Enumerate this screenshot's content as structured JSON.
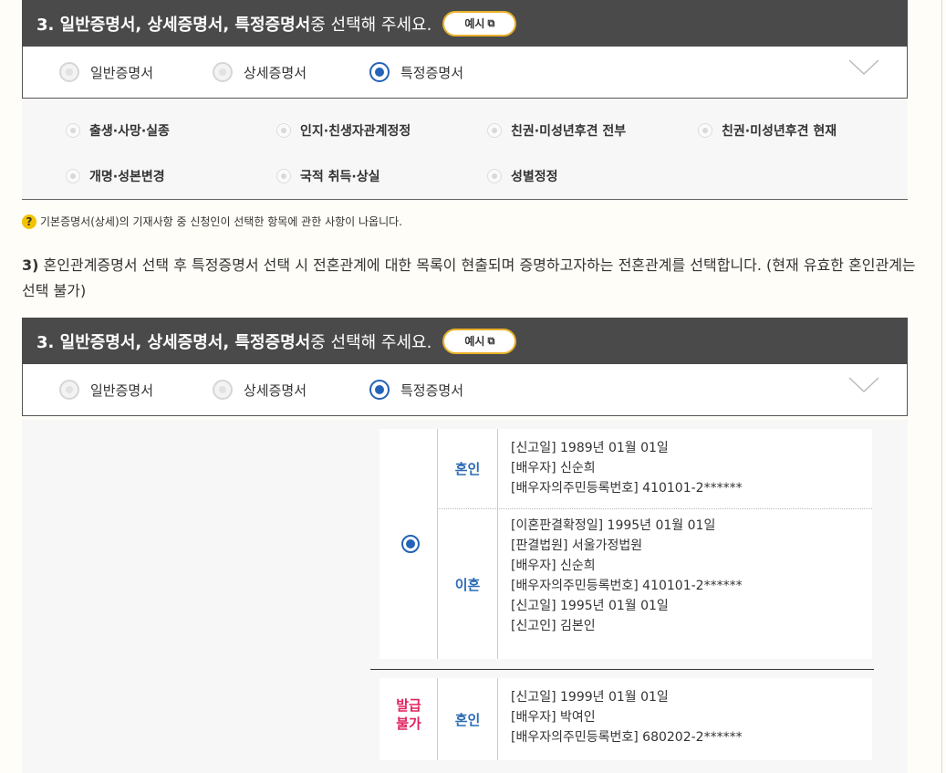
{
  "section_top": {
    "title_part1": "3. 일반증명서, 상세증명서, 특정증명서",
    "title_part2": " 중 선택해 주세요.",
    "example_button": "예시",
    "tabs": [
      "일반증명서",
      "상세증명서",
      "특정증명서"
    ],
    "selected_tab": "특정증명서"
  },
  "sub_options": [
    "출생·사망·실종",
    "인지·친생자관계정정",
    "친권·미성년후견 전부",
    "친권·미성년후견 현재",
    "개명·성본변경",
    "국적 취득·상실",
    "성별정정"
  ],
  "note": "기본증명서(상세)의 기재사항 중 신청인이 선택한 항목에 관한 사항이 나옵니다.",
  "paragraph": {
    "number": "3)",
    "text": " 혼인관계증명서 선택 후 특정증명서 선택 시 전혼관계에 대한 목록이 현출되며 증명하고자하는 전혼관계를 선택합니다. (현재 유효한 혼인관계는 선택 불가)"
  },
  "section_bottom": {
    "title_part1": "3. 일반증명서, 상세증명서, 특정증명서",
    "title_part2": " 중 선택해 주세요.",
    "example_button": "예시",
    "tabs": [
      "일반증명서",
      "상세증명서",
      "특정증명서"
    ],
    "selected_tab": "특정증명서"
  },
  "records": {
    "group1": {
      "selected": true,
      "marriage": {
        "label": "혼인",
        "lines": [
          "[신고일] 1989년 01월 01일",
          "[배우자] 신순희",
          "[배우자의주민등록번호] 410101-2******"
        ]
      },
      "divorce": {
        "label": "이혼",
        "lines": [
          "[이혼판결확정일] 1995년 01월 01일",
          "[판결법원] 서울가정법원",
          "[배우자] 신순희",
          "[배우자의주민등록번호] 410101-2******",
          "[신고일] 1995년 01월 01일",
          "[신고인] 김본인"
        ]
      }
    },
    "group2": {
      "status": "발급\n불가",
      "marriage": {
        "label": "혼인",
        "lines": [
          "[신고일] 1999년 01월 01일",
          "[배우자] 박여인",
          "[배우자의주민등록번호] 680202-2******"
        ]
      }
    }
  }
}
